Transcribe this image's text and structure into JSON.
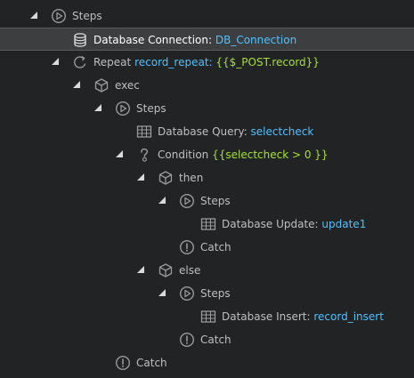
{
  "tree": {
    "rows": [
      {
        "label": "Steps"
      },
      {
        "label": "Database Connection:",
        "value": "DB_Connection"
      },
      {
        "label": "Repeat",
        "value": "record_repeat:",
        "expr": "{{$_POST.record}}"
      },
      {
        "label": "exec"
      },
      {
        "label": "Steps"
      },
      {
        "label": "Database Query:",
        "value": "selectcheck"
      },
      {
        "label": "Condition",
        "expr": "{{selectcheck > 0 }}"
      },
      {
        "label": "then"
      },
      {
        "label": "Steps"
      },
      {
        "label": "Database Update:",
        "value": "update1"
      },
      {
        "label": "Catch"
      },
      {
        "label": "else"
      },
      {
        "label": "Steps"
      },
      {
        "label": "Database Insert:",
        "value": "record_insert"
      },
      {
        "label": "Catch"
      },
      {
        "label": "Catch"
      }
    ]
  },
  "colors": {
    "background": "#222325",
    "selected_row": "#3d3e40",
    "value_blue": "#4fc1ff",
    "value_green": "#a6e22e",
    "icon_gray": "#9a9a9a"
  }
}
